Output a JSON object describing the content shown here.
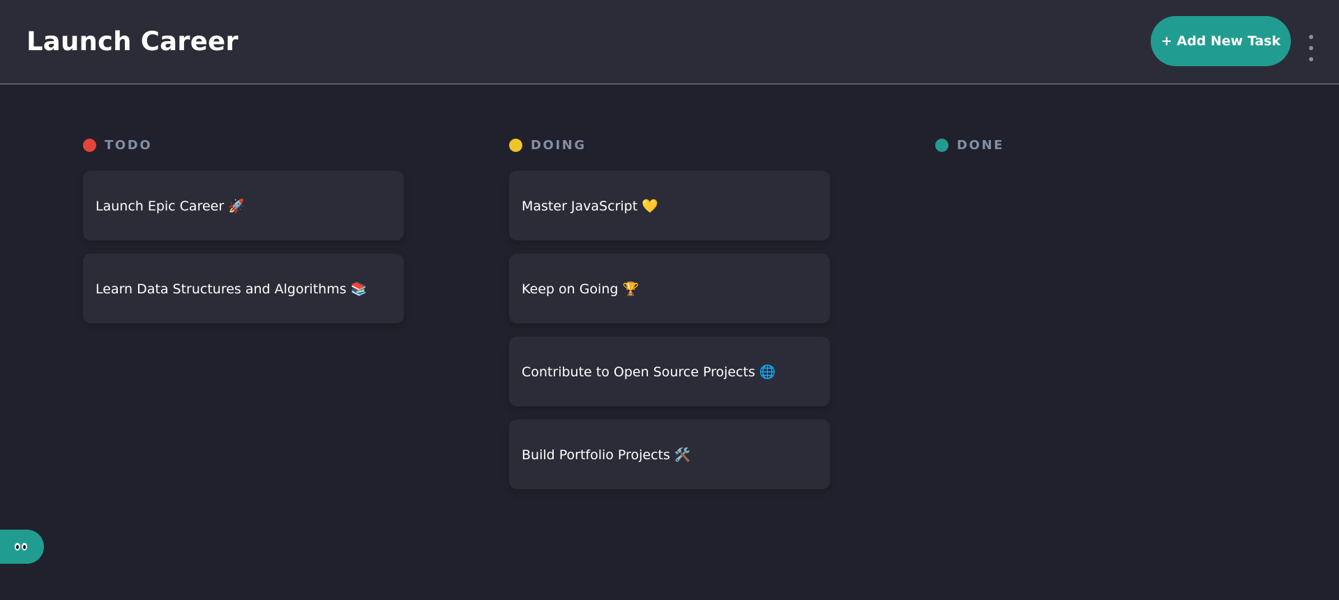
{
  "header": {
    "board_title": "Launch Career",
    "add_task_label": "+ Add New Task"
  },
  "columns": [
    {
      "name": "TODO",
      "color": "#e4453a",
      "tasks": [
        "Launch Epic Career 🚀",
        "Learn Data Structures and Algorithms 📚"
      ]
    },
    {
      "name": "DOING",
      "color": "#f0c52b",
      "tasks": [
        "Master JavaScript 💛",
        "Keep on Going 🏆",
        "Contribute to Open Source Projects 🌐",
        "Build Portfolio Projects 🛠️"
      ]
    },
    {
      "name": "DONE",
      "color": "#219c90",
      "tasks": []
    }
  ],
  "icons": {
    "menu": "kebab-menu-icon",
    "show_sidebar": "eye-icon"
  },
  "colors": {
    "accent": "#219c90",
    "background": "#21212d",
    "surface": "#2b2c37"
  }
}
